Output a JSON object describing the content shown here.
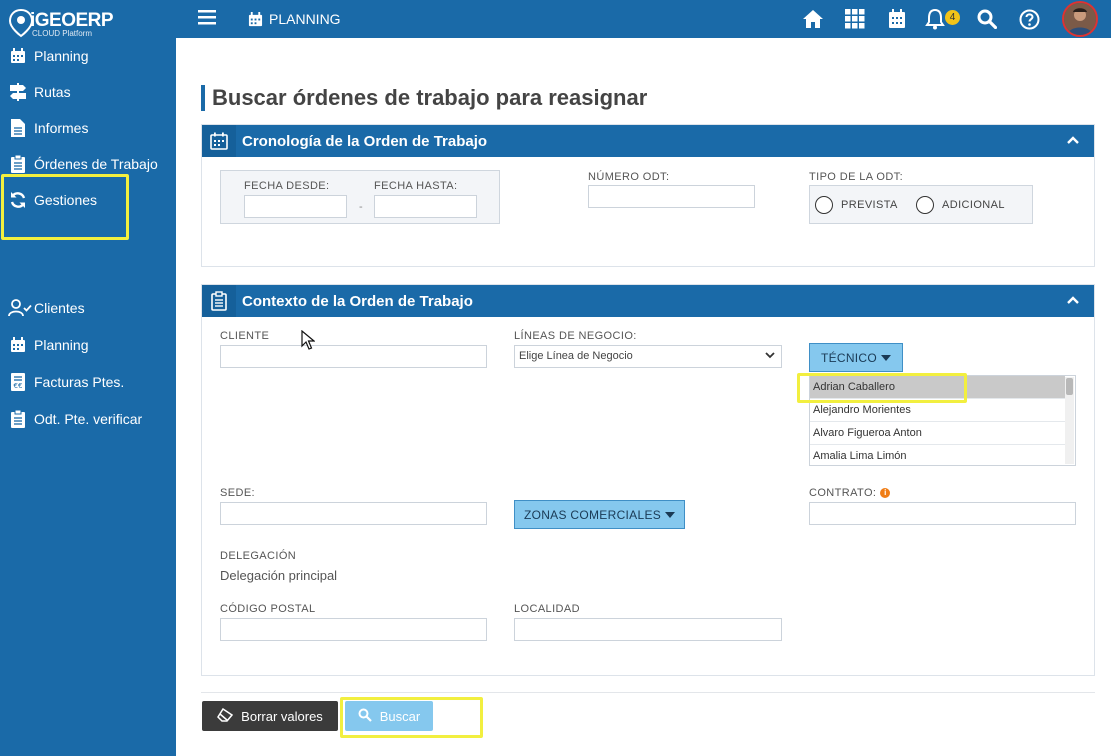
{
  "brand": {
    "name": "iGEOERP",
    "subtitle": "CLOUD Platform"
  },
  "sidebar": {
    "items": [
      {
        "label": "Planning",
        "icon": "calendar-icon"
      },
      {
        "label": "Rutas",
        "icon": "signpost-icon"
      },
      {
        "label": "Informes",
        "icon": "document-icon"
      },
      {
        "label": "Órdenes de Trabajo",
        "icon": "clipboard-icon"
      },
      {
        "label": "Gestiones",
        "icon": "refresh-icon"
      },
      {
        "label": "Clientes",
        "icon": "user-check-icon"
      },
      {
        "label": "Planning",
        "icon": "calendar-icon"
      },
      {
        "label": "Facturas Ptes.",
        "icon": "invoice-icon"
      },
      {
        "label": "Odt. Pte. verificar",
        "icon": "clipboard-icon"
      }
    ]
  },
  "topbar": {
    "section": "PLANNING",
    "notifications_count": "4"
  },
  "page": {
    "title": "Buscar órdenes de trabajo para reasignar"
  },
  "panel1": {
    "title": "Cronología de la Orden de Trabajo",
    "fecha_desde_label": "FECHA DESDE:",
    "fecha_hasta_label": "FECHA HASTA:",
    "range_separator": "-",
    "numero_label": "NÚMERO ODT:",
    "tipo_label": "TIPO DE LA ODT:",
    "tipo_options": [
      "PREVISTA",
      "ADICIONAL"
    ]
  },
  "panel2": {
    "title": "Contexto de la Orden de Trabajo",
    "cliente_label": "CLIENTE",
    "lineas_label": "LÍNEAS DE NEGOCIO:",
    "lineas_value": "Elige Línea de Negocio",
    "tecnico_button": "TÉCNICO",
    "tecnicos": [
      "Adrian Caballero",
      "Alejandro Morientes",
      "Alvaro Figueroa Anton",
      "Amalia Lima Limón"
    ],
    "sede_label": "SEDE:",
    "zonas_button": "ZONAS COMERCIALES",
    "contrato_label": "CONTRATO:",
    "delegacion_label": "DELEGACIÓN",
    "delegacion_value": "Delegación principal",
    "cp_label": "CÓDIGO POSTAL",
    "localidad_label": "LOCALIDAD"
  },
  "actions": {
    "clear": "Borrar valores",
    "search": "Buscar"
  },
  "colors": {
    "primary": "#1a6aa8",
    "highlight": "#f2ef3f",
    "button_light": "#85c8ee"
  }
}
